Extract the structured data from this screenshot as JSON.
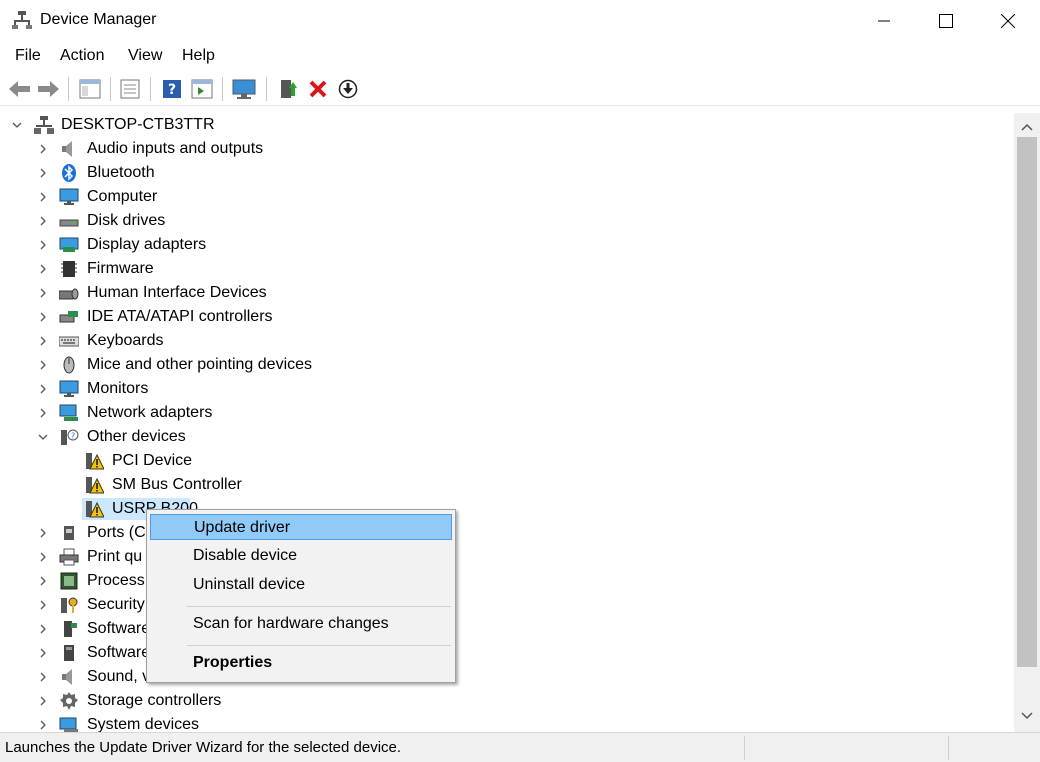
{
  "window": {
    "title": "Device Manager"
  },
  "menu": [
    "File",
    "Action",
    "View",
    "Help"
  ],
  "tree": {
    "root": "DESKTOP-CTB3TTR",
    "categories": [
      "Audio inputs and outputs",
      "Bluetooth",
      "Computer",
      "Disk drives",
      "Display adapters",
      "Firmware",
      "Human Interface Devices",
      "IDE ATA/ATAPI controllers",
      "Keyboards",
      "Mice and other pointing devices",
      "Monitors",
      "Network adapters",
      "Other devices"
    ],
    "other_devices": [
      "PCI Device",
      "SM Bus Controller",
      "USRP B200"
    ],
    "after": [
      "Ports (C",
      "Print qu",
      "Process",
      "Security",
      "Software",
      "Software",
      "Sound, v",
      "Storage controllers",
      "System devices"
    ]
  },
  "context_menu": {
    "update": "Update driver",
    "disable": "Disable device",
    "uninstall": "Uninstall device",
    "scan": "Scan for hardware changes",
    "properties": "Properties"
  },
  "status": {
    "text": "Launches the Update Driver Wizard for the selected device."
  }
}
